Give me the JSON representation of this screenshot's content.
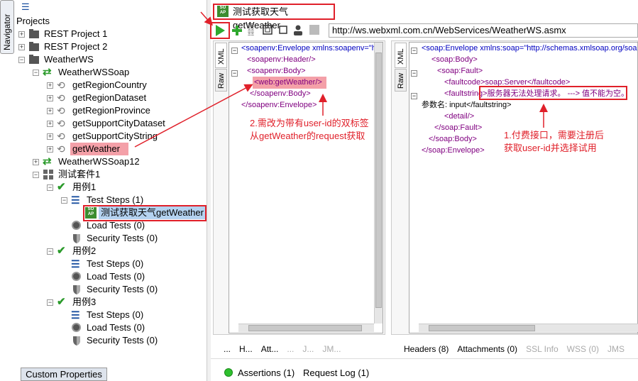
{
  "navigator": {
    "tab_label": "Navigator",
    "projects_label": "Projects",
    "tree": [
      {
        "label": "REST Project 1",
        "icon": "folder-icon"
      },
      {
        "label": "REST Project 2",
        "icon": "folder-icon"
      },
      {
        "label": "WeatherWS",
        "icon": "folder-icon"
      },
      {
        "label": "WeatherWSSoap",
        "icon": "interface-icon"
      },
      {
        "label": "getRegionCountry",
        "icon": "operation-icon"
      },
      {
        "label": "getRegionDataset",
        "icon": "operation-icon"
      },
      {
        "label": "getRegionProvince",
        "icon": "operation-icon"
      },
      {
        "label": "getSupportCityDataset",
        "icon": "operation-icon"
      },
      {
        "label": "getSupportCityString",
        "icon": "operation-icon"
      },
      {
        "label": "getWeather",
        "icon": "operation-icon"
      },
      {
        "label": "WeatherWSSoap12",
        "icon": "interface-icon"
      },
      {
        "label": "测试套件1",
        "icon": "testsuite-icon"
      },
      {
        "label": "用例1",
        "icon": "check-icon"
      },
      {
        "label": "Test Steps (1)",
        "icon": "list-icon"
      },
      {
        "label": "测试获取天气getWeather",
        "icon": "soap-request-icon"
      },
      {
        "label": "Load Tests (0)",
        "icon": "load-icon"
      },
      {
        "label": "Security Tests (0)",
        "icon": "shield-icon"
      },
      {
        "label": "用例2",
        "icon": "check-icon"
      },
      {
        "label": "Test Steps (0)",
        "icon": "list-icon"
      },
      {
        "label": "Load Tests (0)",
        "icon": "load-icon"
      },
      {
        "label": "Security Tests (0)",
        "icon": "shield-icon"
      },
      {
        "label": "用例3",
        "icon": "check-icon"
      },
      {
        "label": "Test Steps (0)",
        "icon": "list-icon"
      },
      {
        "label": "Load Tests (0)",
        "icon": "load-icon"
      },
      {
        "label": "Security Tests (0)",
        "icon": "shield-icon"
      }
    ],
    "custom_properties": "Custom Properties"
  },
  "editor": {
    "title": "测试获取天气getWeather",
    "soap_icon_text": "SOAP",
    "url": "http://ws.webxml.com.cn/WebServices/WeatherWS.asmx",
    "request": {
      "xml_tab": "XML",
      "raw_tab": "Raw",
      "lines": [
        "<soapenv:Envelope xmlns:soapenv=\"h",
        "<soapenv:Header/>",
        "<soapenv:Body>",
        "<web:getWeather/>",
        "</soapenv:Body>",
        "</soapenv:Envelope>"
      ],
      "bottom_tabs": [
        "...",
        "H...",
        "Att...",
        "...",
        "J...",
        "JM..."
      ]
    },
    "response": {
      "xml_tab": "XML",
      "raw_tab": "Raw",
      "lines": [
        "<soap:Envelope xmlns:soap=\"http://schemas.xmlsoap.org/soap/",
        "<soap:Body>",
        "<soap:Fault>",
        "<faultcode>soap:Server</faultcode>",
        "<faultstring>服务器无法处理请求。 ---> 值不能为空。",
        "参数名: input</faultstring>",
        "<detail/>",
        "</soap:Fault>",
        "</soap:Body>",
        "</soap:Envelope>"
      ],
      "bottom_tabs": [
        "Headers (8)",
        "Attachments (0)",
        "SSL Info",
        "WSS (0)",
        "JMS"
      ]
    },
    "footer": {
      "assertions": "Assertions (1)",
      "request_log": "Request Log (1)"
    }
  },
  "annotations": {
    "note2_line1": "2.需改为带有user-id的双标签",
    "note2_line2": "从getWeather的request获取",
    "note1_line1": "1.付费接口，需要注册后",
    "note1_line2": "获取user-id并选择试用"
  },
  "colors": {
    "annotation_red": "#e0202a",
    "highlight_pink": "#f4a0a8",
    "selection_blue": "#b4d2f0",
    "soap_green": "#3c8d2f"
  }
}
